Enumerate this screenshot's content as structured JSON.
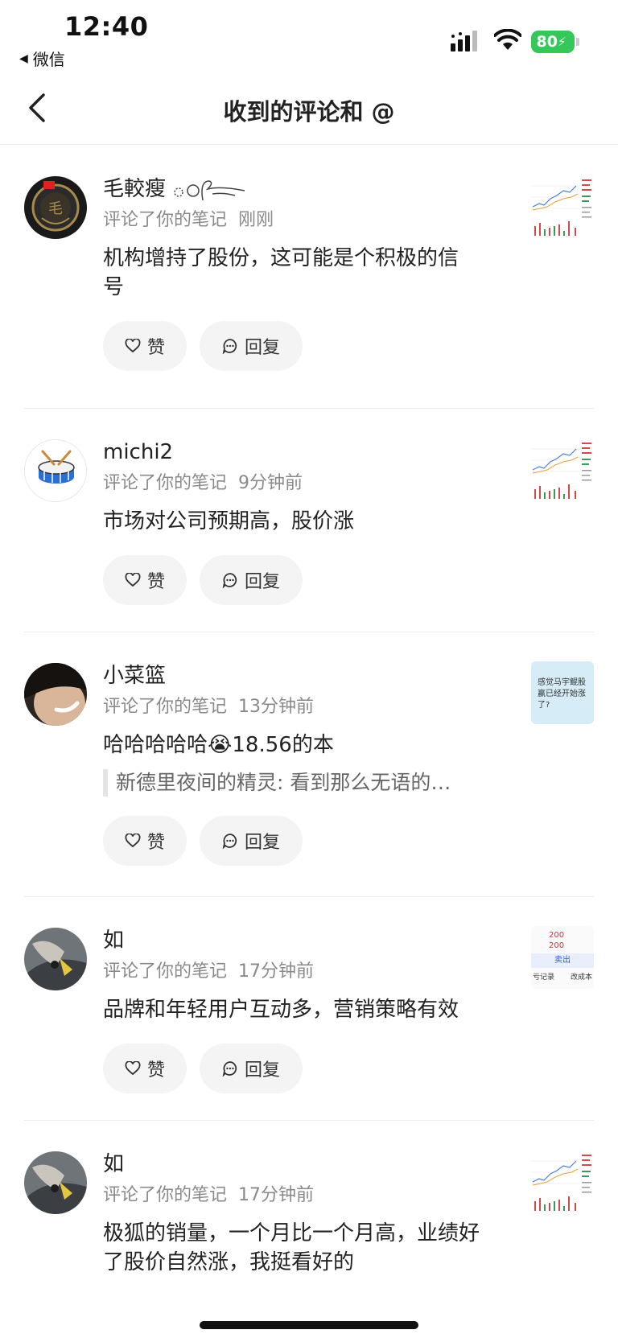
{
  "status_bar": {
    "time": "12:40",
    "back_app": "微信",
    "battery": "80"
  },
  "nav": {
    "title": "收到的评论和 @",
    "back_icon": "chevron-left-icon"
  },
  "comments": [
    {
      "user": "毛較瘦",
      "action": "评论了你的笔记",
      "time": "刚刚",
      "text": "机构增持了股份，这可能是个积极的信号",
      "like_label": "赞",
      "reply_label": "回复",
      "thumb": "chart-thumbnail"
    },
    {
      "user": "michi2",
      "action": "评论了你的笔记",
      "time": "9分钟前",
      "text": "市场对公司预期高，股价涨",
      "like_label": "赞",
      "reply_label": "回复",
      "thumb": "chart-thumbnail"
    },
    {
      "user": "小菜篮",
      "action": "评论了你的笔记",
      "time": "13分钟前",
      "text": "哈哈哈哈哈😭18.56的本",
      "quote": "新德里夜间的精灵: 看到那么无语的…",
      "like_label": "赞",
      "reply_label": "回复",
      "thumb_text": "感觉马宇鲲股赢已经开始涨了?"
    },
    {
      "user": "如",
      "action": "评论了你的笔记",
      "time": "17分钟前",
      "text": "品牌和年轻用户互动多，营销策略有效",
      "like_label": "赞",
      "reply_label": "回复",
      "thumb_lines": [
        "200",
        "200",
        "卖出",
        "亏记录",
        "改成本"
      ]
    },
    {
      "user": "如",
      "action": "评论了你的笔记",
      "time": "17分钟前",
      "text": "极狐的销量，一个月比一个月高，业绩好了股价自然涨，我挺看好的",
      "thumb": "chart-thumbnail"
    }
  ],
  "colors": {
    "battery": "#35c759",
    "meta_text": "#8a8a8a",
    "button_bg": "#f4f4f4",
    "divider": "#ececec"
  }
}
